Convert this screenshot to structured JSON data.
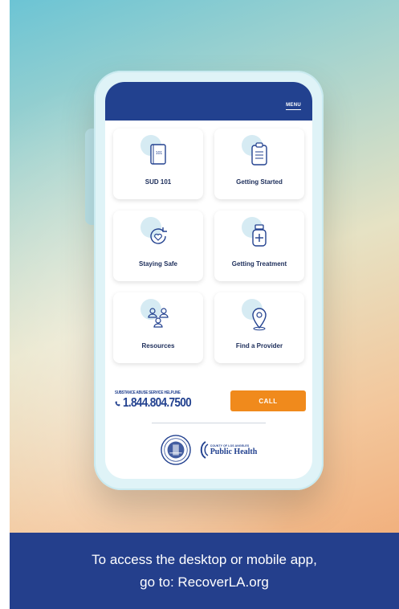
{
  "app": {
    "menu_label": "MENU"
  },
  "tiles": [
    {
      "label": "SUD 101",
      "icon": "book-icon",
      "book_text": "101"
    },
    {
      "label": "Getting Started",
      "icon": "clipboard-icon"
    },
    {
      "label": "Staying Safe",
      "icon": "refresh-heart-icon"
    },
    {
      "label": "Getting Treatment",
      "icon": "medicine-bottle-icon"
    },
    {
      "label": "Resources",
      "icon": "people-icon"
    },
    {
      "label": "Find a Provider",
      "icon": "map-pin-icon"
    }
  ],
  "helpline": {
    "title": "SUBSTANCE ABUSE SERVICE HELPLINE",
    "number": "1.844.804.7500",
    "call_label": "CALL"
  },
  "logos": {
    "county_small": "COUNTY OF LOS ANGELES",
    "public_health": "Public Health"
  },
  "banner": {
    "line1": "To access the desktop or mobile app,",
    "line2": "go to: RecoverLA.org"
  },
  "colors": {
    "header_blue": "#22418f",
    "call_orange": "#f08a1c",
    "banner_blue": "#243f8c"
  }
}
